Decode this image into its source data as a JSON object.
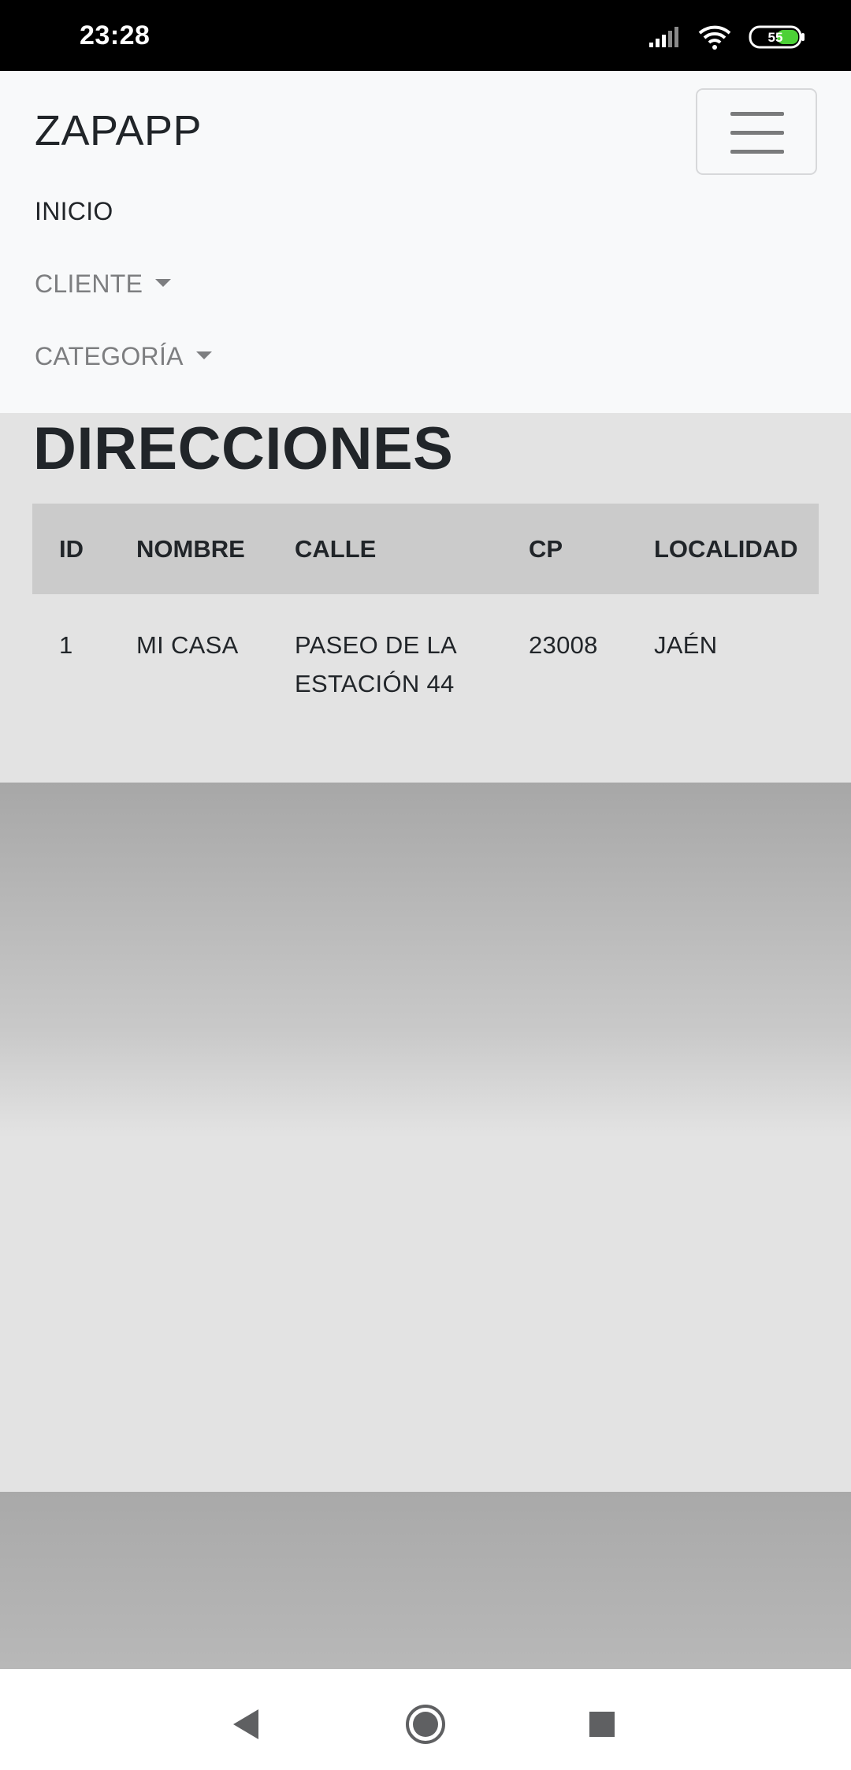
{
  "status_bar": {
    "time": "23:28",
    "battery_level": "55",
    "icons": [
      "signal-icon",
      "wifi-icon",
      "battery-icon"
    ]
  },
  "navbar": {
    "brand": "ZAPAPP",
    "toggler_icon": "hamburger-menu-icon",
    "items": [
      {
        "label": "INICIO",
        "has_dropdown": false
      },
      {
        "label": "CLIENTE",
        "has_dropdown": true
      },
      {
        "label": "CATEGORÍA",
        "has_dropdown": true
      }
    ]
  },
  "page": {
    "title": "DIRECCIONES"
  },
  "table": {
    "columns": [
      "ID",
      "NOMBRE",
      "CALLE",
      "CP",
      "LOCALIDAD"
    ],
    "rows": [
      {
        "id": "1",
        "nombre": "MI CASA",
        "calle": "PASEO DE LA ESTACIÓN 44",
        "cp": "23008",
        "localidad": "JAÉN"
      }
    ]
  },
  "system_nav": {
    "buttons": [
      "back-icon",
      "home-icon",
      "recents-icon"
    ]
  },
  "colors": {
    "navbar_bg": "#f8f9fa",
    "content_bg": "#e3e3e3",
    "table_header_bg": "#cbcbcb",
    "text": "#212529",
    "muted_text": "#7d7e80",
    "battery_fill": "#4cd137"
  }
}
